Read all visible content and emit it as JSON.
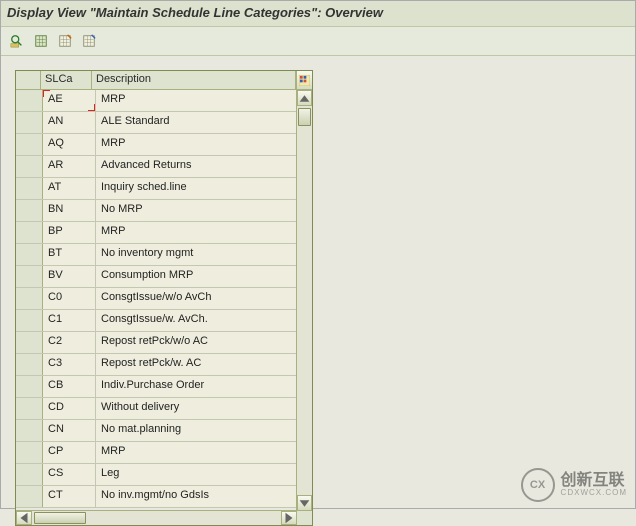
{
  "title": "Display View \"Maintain Schedule Line Categories\": Overview",
  "toolbar_icons": [
    "detail",
    "select-all",
    "deselect-all",
    "print"
  ],
  "grid": {
    "headers": {
      "slca": "SLCa",
      "description": "Description"
    },
    "rows": [
      {
        "code": "AE",
        "desc": "MRP"
      },
      {
        "code": "AN",
        "desc": "ALE Standard"
      },
      {
        "code": "AQ",
        "desc": "MRP"
      },
      {
        "code": "AR",
        "desc": "Advanced Returns"
      },
      {
        "code": "AT",
        "desc": "Inquiry sched.line"
      },
      {
        "code": "BN",
        "desc": "No MRP"
      },
      {
        "code": "BP",
        "desc": "MRP"
      },
      {
        "code": "BT",
        "desc": "No inventory mgmt"
      },
      {
        "code": "BV",
        "desc": "Consumption MRP"
      },
      {
        "code": "C0",
        "desc": "ConsgtIssue/w/o AvCh"
      },
      {
        "code": "C1",
        "desc": "ConsgtIssue/w. AvCh."
      },
      {
        "code": "C2",
        "desc": "Repost retPck/w/o AC"
      },
      {
        "code": "C3",
        "desc": "Repost retPck/w. AC"
      },
      {
        "code": "CB",
        "desc": "Indiv.Purchase Order"
      },
      {
        "code": "CD",
        "desc": "Without delivery"
      },
      {
        "code": "CN",
        "desc": "No mat.planning"
      },
      {
        "code": "CP",
        "desc": "MRP"
      },
      {
        "code": "CS",
        "desc": "Leg"
      },
      {
        "code": "CT",
        "desc": "No inv.mgmt/no GdsIs"
      }
    ]
  },
  "watermark": {
    "logo_text": "CX",
    "cn": "创新互联",
    "en": "CDXWCX.COM"
  }
}
